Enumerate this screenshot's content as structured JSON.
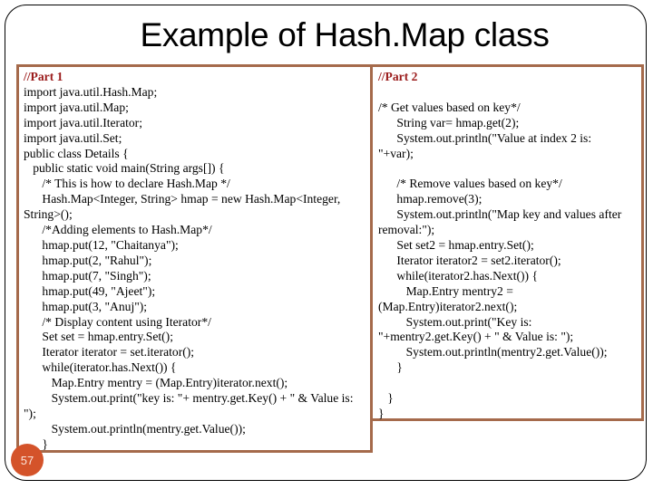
{
  "slide": {
    "title": "Example of Hash.Map class",
    "slide_number": "57",
    "colors": {
      "box_border": "#a56a4b",
      "part_label": "#9b1c1c",
      "slide_number_bg": "#d4532a"
    }
  },
  "left_panel": {
    "label": "//Part 1",
    "lines": [
      "import java.util.Hash.Map;",
      "import java.util.Map;",
      "import java.util.Iterator;",
      "import java.util.Set;",
      "public class Details {",
      "   public static void main(String args[]) {",
      "      /* This is how to declare Hash.Map */",
      "      Hash.Map<Integer, String> hmap = new Hash.Map<Integer,",
      "String>();",
      "      /*Adding elements to Hash.Map*/",
      "      hmap.put(12, \"Chaitanya\");",
      "      hmap.put(2, \"Rahul\");",
      "      hmap.put(7, \"Singh\");",
      "      hmap.put(49, \"Ajeet\");",
      "      hmap.put(3, \"Anuj\");",
      "      /* Display content using Iterator*/",
      "      Set set = hmap.entry.Set();",
      "      Iterator iterator = set.iterator();",
      "      while(iterator.has.Next()) {",
      "         Map.Entry mentry = (Map.Entry)iterator.next();",
      "         System.out.print(\"key is: \"+ mentry.get.Key() + \" & Value is:",
      "\");",
      "         System.out.println(mentry.get.Value());",
      "      }"
    ]
  },
  "right_panel": {
    "label": "//Part 2",
    "lines": [
      "",
      "/* Get values based on key*/",
      "      String var= hmap.get(2);",
      "      System.out.println(\"Value at index 2 is:",
      "\"+var);",
      "",
      "      /* Remove values based on key*/",
      "      hmap.remove(3);",
      "      System.out.println(\"Map key and values after",
      "removal:\");",
      "      Set set2 = hmap.entry.Set();",
      "      Iterator iterator2 = set2.iterator();",
      "      while(iterator2.has.Next()) {",
      "         Map.Entry mentry2 =",
      "(Map.Entry)iterator2.next();",
      "         System.out.print(\"Key is:",
      "\"+mentry2.get.Key() + \" & Value is: \");",
      "         System.out.println(mentry2.get.Value());",
      "      }",
      "",
      "   }",
      "}"
    ]
  }
}
